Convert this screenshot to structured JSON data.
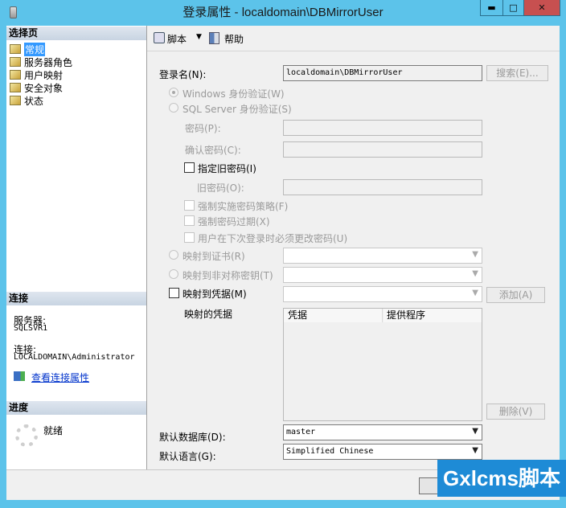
{
  "window": {
    "title": "登录属性 - localdomain\\DBMirrorUser",
    "minimize": "▬",
    "maximize": "□",
    "close": "✕"
  },
  "left": {
    "select_page_header": "选择页",
    "pages": [
      {
        "label": "常规",
        "selected": true
      },
      {
        "label": "服务器角色"
      },
      {
        "label": "用户映射"
      },
      {
        "label": "安全对象"
      },
      {
        "label": "状态"
      }
    ],
    "connection_header": "连接",
    "server_label": "服务器:",
    "server_value": "SQLSVR1",
    "connection_label": "连接:",
    "connection_value": "LOCALDOMAIN\\Administrator",
    "view_connection_link": "查看连接属性",
    "progress_header": "进度",
    "progress_status": "就绪"
  },
  "toolbar": {
    "script": "脚本",
    "help": "帮助"
  },
  "form": {
    "login_name_label": "登录名(N):",
    "login_name_value": "localdomain\\DBMirrorUser",
    "search_button": "搜索(E)...",
    "windows_auth": "Windows 身份验证(W)",
    "windows_auth_selected": true,
    "sql_auth": "SQL Server 身份验证(S)",
    "sql_auth_selected": false,
    "password_label": "密码(P):",
    "confirm_password_label": "确认密码(C):",
    "specify_old_password": "指定旧密码(I)",
    "specify_old_password_checked": false,
    "old_password_label": "旧密码(O):",
    "enforce_policy": "强制实施密码策略(F)",
    "enforce_expiration": "强制密码过期(X)",
    "must_change": "用户在下次登录时必须更改密码(U)",
    "map_cert": "映射到证书(R)",
    "map_asym_key": "映射到非对称密钥(T)",
    "map_credential": "映射到凭据(M)",
    "map_credential_checked": false,
    "add_button": "添加(A)",
    "mapped_credentials_label": "映射的凭据",
    "credentials_columns": [
      "凭据",
      "提供程序"
    ],
    "remove_button": "删除(V)",
    "default_db_label": "默认数据库(D):",
    "default_db_value": "master",
    "default_lang_label": "默认语言(G):",
    "default_lang_value": "Simplified Chinese"
  },
  "watermark": "Gxlcms脚本",
  "colors": {
    "window_border": "#5cc3ea",
    "close_button": "#c75050",
    "selection": "#3399ff",
    "link": "#0033cc",
    "watermark_bg": "#1e8bd6"
  }
}
